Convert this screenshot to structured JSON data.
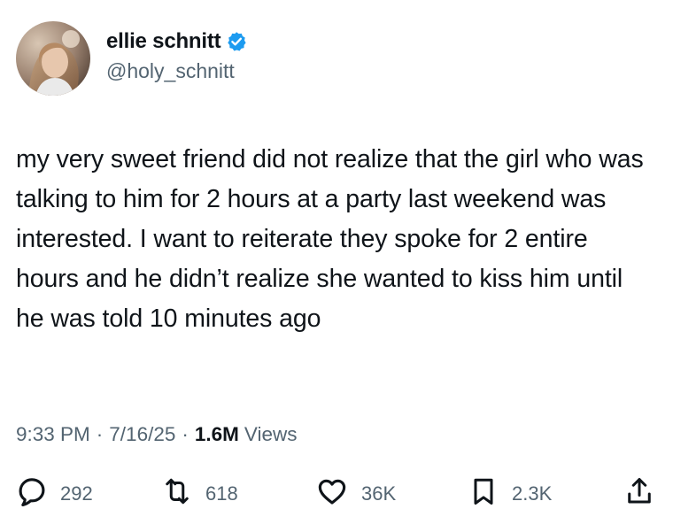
{
  "author": {
    "display_name": "ellie schnitt",
    "handle": "@holy_schnitt",
    "verified": true,
    "avatar_icon": "profile-photo",
    "verified_icon": "verified-badge-icon"
  },
  "tweet": {
    "text": "my very sweet friend did not realize that the girl who was talking to him for 2 hours at a party last weekend was interested. I want to reiterate they spoke for 2 entire hours and he didn’t realize she wanted to kiss him until he was told 10 minutes ago"
  },
  "meta": {
    "time": "9:33 PM",
    "separator": "·",
    "date": "7/16/25",
    "views_count": "1.6M",
    "views_label": "Views"
  },
  "actions": {
    "replies": {
      "icon": "reply-icon",
      "count": "292"
    },
    "reposts": {
      "icon": "repost-icon",
      "count": "618"
    },
    "likes": {
      "icon": "heart-icon",
      "count": "36K"
    },
    "bookmarks": {
      "icon": "bookmark-icon",
      "count": "2.3K"
    },
    "share": {
      "icon": "share-icon"
    }
  },
  "colors": {
    "text_primary": "#0f1419",
    "text_secondary": "#536471",
    "verified_blue": "#1d9bf0"
  }
}
